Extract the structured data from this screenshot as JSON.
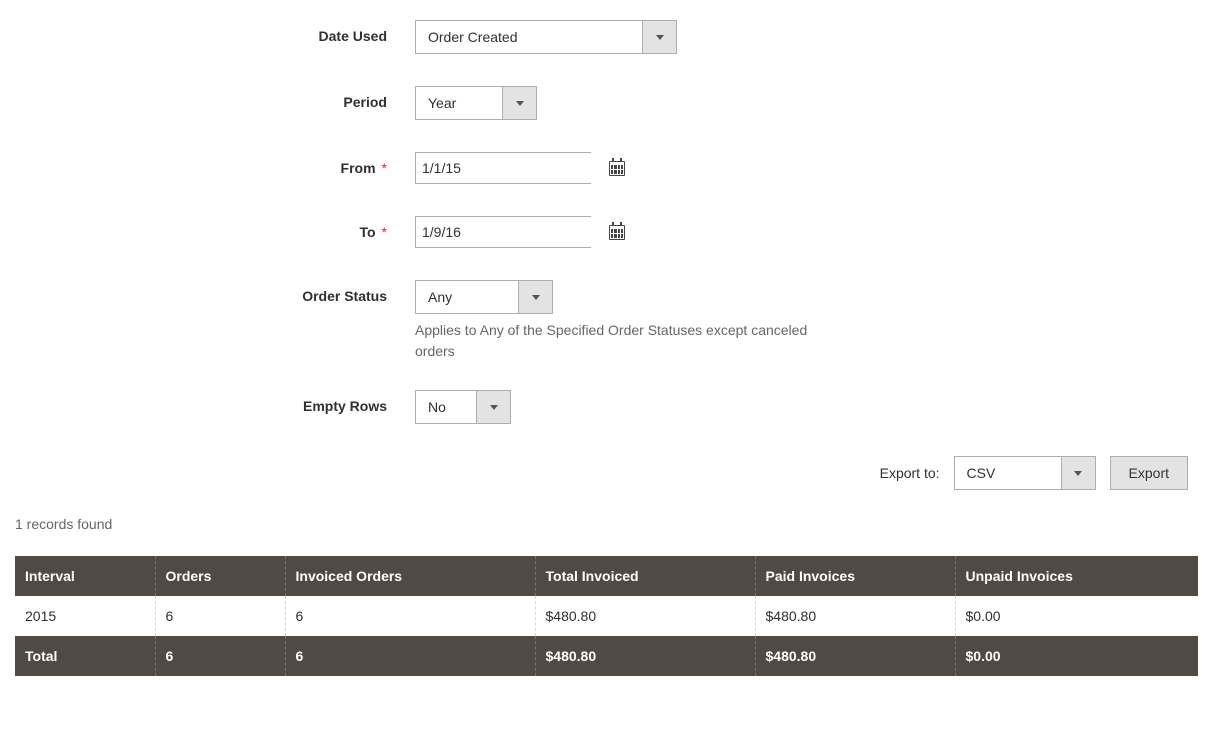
{
  "form": {
    "date_used": {
      "label": "Date Used",
      "value": "Order Created"
    },
    "period": {
      "label": "Period",
      "value": "Year"
    },
    "from": {
      "label": "From",
      "value": "1/1/15"
    },
    "to": {
      "label": "To",
      "value": "1/9/16"
    },
    "order_status": {
      "label": "Order Status",
      "value": "Any",
      "hint": "Applies to Any of the Specified Order Statuses except canceled orders"
    },
    "empty_rows": {
      "label": "Empty Rows",
      "value": "No"
    }
  },
  "export": {
    "label": "Export to:",
    "format": "CSV",
    "button": "Export"
  },
  "records_found": "1 records found",
  "table": {
    "headers": {
      "interval": "Interval",
      "orders": "Orders",
      "invoiced_orders": "Invoiced Orders",
      "total_invoiced": "Total Invoiced",
      "paid_invoices": "Paid Invoices",
      "unpaid_invoices": "Unpaid Invoices"
    },
    "rows": [
      {
        "interval": "2015",
        "orders": "6",
        "invoiced_orders": "6",
        "total_invoiced": "$480.80",
        "paid_invoices": "$480.80",
        "unpaid_invoices": "$0.00"
      }
    ],
    "total": {
      "label": "Total",
      "orders": "6",
      "invoiced_orders": "6",
      "total_invoiced": "$480.80",
      "paid_invoices": "$480.80",
      "unpaid_invoices": "$0.00"
    }
  }
}
